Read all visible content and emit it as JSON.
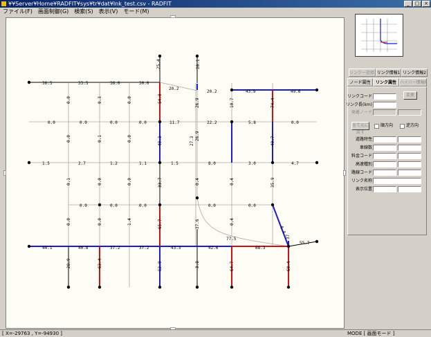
{
  "window": {
    "title": "¥¥Server¥Home¥RADFIT¥sys¥tr¥dat¥lnk_test.csv - RADFIT",
    "min_symbol": "_",
    "max_symbol": "□",
    "close_symbol": "×"
  },
  "menu": [
    "ファイル(F)",
    "画面制御(G)",
    "検索(S)",
    "表示(V)",
    "モード(M)"
  ],
  "tabs_top": [
    {
      "label": "リンク一括修正",
      "state": "disabled"
    },
    {
      "label": "リンク情報1",
      "state": "normal"
    },
    {
      "label": "リンク情報2",
      "state": "normal"
    }
  ],
  "tabs_bottom": [
    {
      "label": "ノード属性",
      "state": "normal"
    },
    {
      "label": "リンク属性",
      "state": "active"
    },
    {
      "label": "ハイバー情報修正",
      "state": "disabled"
    }
  ],
  "form": {
    "link_code": "リンクコード",
    "link_length": "リンク長(km)",
    "origin_node": "発着ノード",
    "change_button": "変更",
    "restore_button": "全て元に戻す",
    "forward": "順方向",
    "reverse": "逆方向",
    "attributes": [
      "道路特性",
      "車線数",
      "料金コード",
      "高速種別",
      "路線コード",
      "リンク名称",
      "表示位置"
    ]
  },
  "status": {
    "coords": "[ X=-29763 , Y=-94930 ]",
    "mode": "MODE [ 画面モード ]"
  },
  "colors": {
    "road_default": "#000000",
    "road_blue": "#1a1ad0",
    "road_red": "#d01010",
    "minor_road": "#a8a8a8",
    "canvas_bg": "#fdfdf5"
  },
  "map": {
    "link_labels": [
      "25.4",
      "28.1",
      "36.5",
      "33.5",
      "36.0",
      "30.0",
      "20.2",
      "20.2",
      "43.9",
      "49.6",
      "0.0",
      "0.3",
      "0.0",
      "54.0",
      "11.7",
      "26.9",
      "10.7",
      "74.4",
      "0.0",
      "0.0",
      "0.0",
      "0.0",
      "22.2",
      "5.8",
      "0.0",
      "0.0",
      "0.1",
      "0.0",
      "40.3",
      "27.3",
      "26.9",
      "40.7",
      "1.5",
      "2.7",
      "1.2",
      "1.1",
      "1.5",
      "8.0",
      "3.0",
      "4.7",
      "0.1",
      "0.0",
      "0.0",
      "33.7",
      "0.4",
      "0.4",
      "35.9",
      "0.0",
      "0.0",
      "0.0",
      "0.0",
      "0.0",
      "0.0",
      "0.0",
      "1.4",
      "65.7",
      "37.6",
      "0.4",
      "6.4",
      "77.5",
      "55.7",
      "44.1",
      "40.8",
      "37.2",
      "37.2",
      "43.3",
      "42.6",
      "68.3",
      "37",
      "28.9",
      "63.4",
      "52.0",
      "3.8",
      "64.7",
      "60.4"
    ]
  }
}
